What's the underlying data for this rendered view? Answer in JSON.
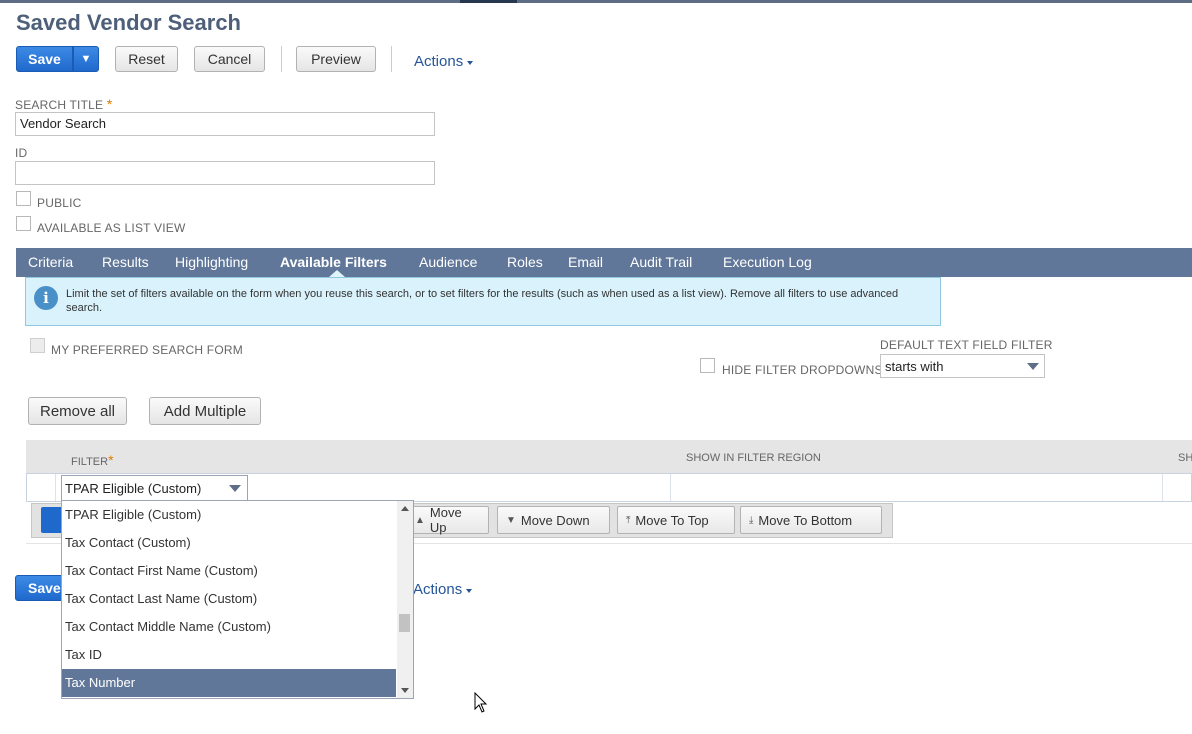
{
  "page": {
    "title": "Saved Vendor Search"
  },
  "toolbar": {
    "save": "Save",
    "save_arrow": "▼",
    "reset": "Reset",
    "cancel": "Cancel",
    "preview": "Preview",
    "actions": "Actions"
  },
  "form": {
    "search_title_label": "SEARCH TITLE",
    "required_mark": "*",
    "search_title_value": "Vendor Search",
    "id_label": "ID",
    "id_value": "",
    "public_label": "PUBLIC",
    "list_view_label": "AVAILABLE AS LIST VIEW"
  },
  "tabs": [
    {
      "label": "Criteria"
    },
    {
      "label": "Results"
    },
    {
      "label": "Highlighting"
    },
    {
      "label": "Available Filters"
    },
    {
      "label": "Audience"
    },
    {
      "label": "Roles"
    },
    {
      "label": "Email"
    },
    {
      "label": "Audit Trail"
    },
    {
      "label": "Execution Log"
    }
  ],
  "info": {
    "text": "Limit the set of filters available on the form when you reuse this search, or to set filters for the results (such as when used as a list view). Remove all filters to use advanced search."
  },
  "options": {
    "preferred_form_label": "MY PREFERRED SEARCH FORM",
    "hide_dropdowns_label": "HIDE FILTER DROPDOWNS",
    "default_filter_label": "DEFAULT TEXT FIELD FILTER",
    "default_filter_value": "starts with"
  },
  "buttons": {
    "remove_all": "Remove all",
    "add_multiple": "Add Multiple"
  },
  "grid": {
    "headers": {
      "filter": "FILTER",
      "show_in_region": "SHOW IN FILTER REGION",
      "sh": "SH"
    },
    "row_filter_value": "TPAR Eligible (Custom)"
  },
  "row_actions": {
    "move_up": "Move Up",
    "move_down": "Move Down",
    "move_to_top": "Move To Top",
    "move_to_bottom": "Move To Bottom"
  },
  "bottom": {
    "save": "Save",
    "actions": "Actions"
  },
  "dropdown": {
    "items": [
      {
        "label": "TPAR Eligible (Custom)",
        "selected": false
      },
      {
        "label": "Tax Contact (Custom)",
        "selected": false
      },
      {
        "label": "Tax Contact First Name (Custom)",
        "selected": false
      },
      {
        "label": "Tax Contact Last Name (Custom)",
        "selected": false
      },
      {
        "label": "Tax Contact Middle Name (Custom)",
        "selected": false
      },
      {
        "label": "Tax ID",
        "selected": false
      },
      {
        "label": "Tax Number",
        "selected": true
      }
    ]
  },
  "colors": {
    "accent": "#1f69cc",
    "tabbar": "#607799",
    "title": "#4d5f79",
    "info_bg": "#d9f2fc",
    "link": "#255599"
  }
}
